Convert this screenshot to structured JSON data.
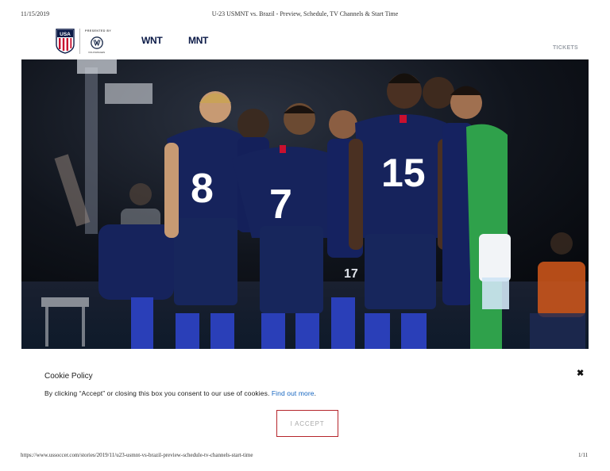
{
  "print": {
    "date": "11/15/2019",
    "title": "U-23 USMNT vs. Brazil - Preview, Schedule, TV Channels & Start Time",
    "url": "https://www.ussoccer.com/stories/2019/11/u23-usmnt-vs-brazil-preview-schedule-tv-channels-start-time",
    "page": "1/11"
  },
  "header": {
    "crest_text": "USA",
    "presented_by": "PRESENTED BY",
    "sponsor_icon": "volkswagen-logo",
    "sponsor_text": "VOLKSWAGEN",
    "nav": [
      "WNT",
      "MNT"
    ],
    "tickets": "TICKETS"
  },
  "hero": {
    "jersey_numbers": [
      "8",
      "7",
      "15",
      "17"
    ],
    "colors": {
      "kit": "#16235c",
      "keeper": "#2fa14b",
      "socks": "#2a3fb8"
    }
  },
  "cookie": {
    "title": "Cookie Policy",
    "body": "By clicking “Accept” or closing this box you consent to our use of cookies. ",
    "link": "Find out more",
    "period": ".",
    "accept": "I ACCEPT",
    "close_icon": "close-icon"
  },
  "colors": {
    "accent": "#b5252c",
    "link": "#1565c0",
    "navy": "#0b1a47"
  }
}
